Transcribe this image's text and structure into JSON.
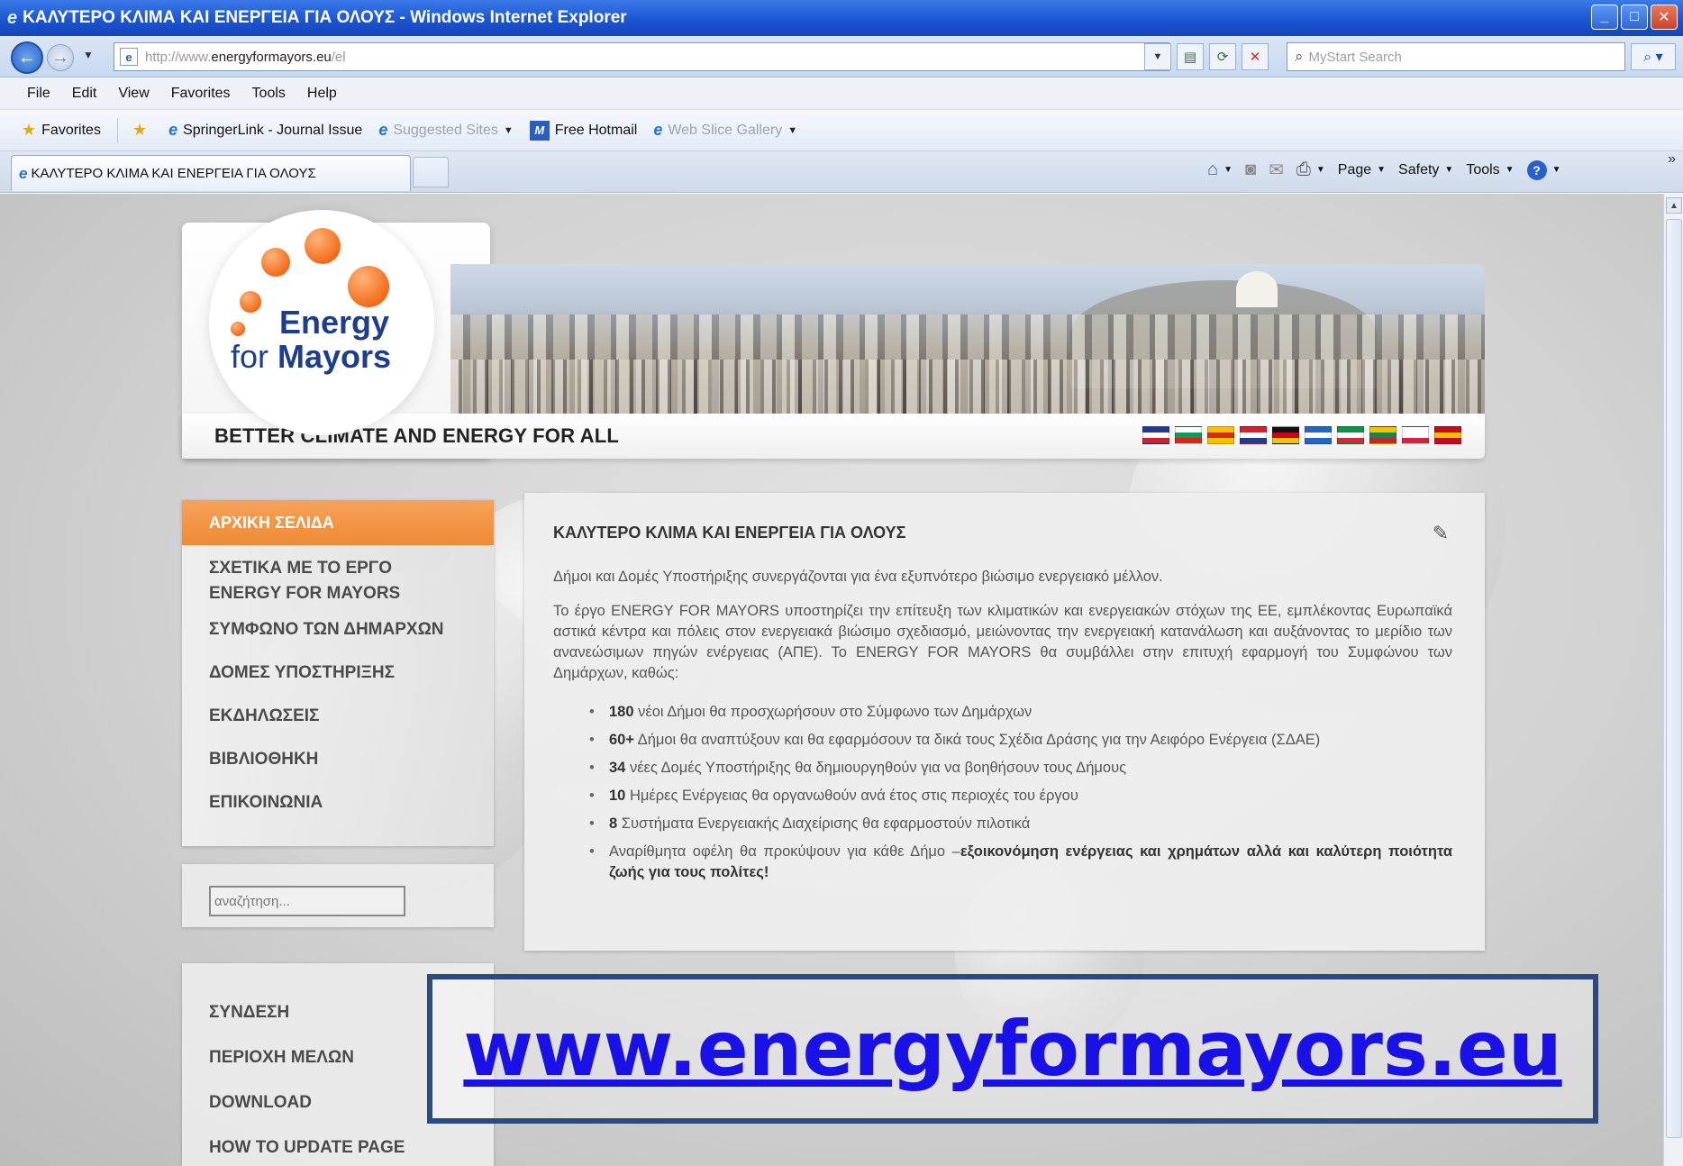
{
  "window": {
    "title": "ΚΑΛΥΤΕΡΟ ΚΛΙΜΑ ΚΑΙ ΕΝΕΡΓΕΙΑ ΓΙΑ ΟΛΟΥΣ - Windows Internet Explorer",
    "controls": {
      "minimize": "_",
      "maximize": "□",
      "close": "✕"
    }
  },
  "address_bar": {
    "url_prefix": "http://www.",
    "url_domain": "energyformayors.eu",
    "url_suffix": "/el",
    "search_placeholder": "MyStart Search"
  },
  "menu": [
    "File",
    "Edit",
    "View",
    "Favorites",
    "Tools",
    "Help"
  ],
  "favorites_bar": {
    "favorites_label": "Favorites",
    "items": [
      {
        "label": "SpringerLink - Journal Issue",
        "dim": false
      },
      {
        "label": "Suggested Sites",
        "dim": true
      },
      {
        "label": "Free Hotmail",
        "dim": false
      },
      {
        "label": "Web Slice Gallery",
        "dim": true
      }
    ]
  },
  "tab": {
    "title": "ΚΑΛΥΤΕΡΟ ΚΛΙΜΑ ΚΑΙ ΕΝΕΡΓΕΙΑ ΓΙΑ ΟΛΟΥΣ"
  },
  "command_bar": {
    "page": "Page",
    "safety": "Safety",
    "tools": "Tools"
  },
  "site": {
    "logo": {
      "line1": "Energy",
      "line2_prefix": "for ",
      "line2_bold": "Mayors"
    },
    "tagline": "BETTER CLIMATE AND ENERGY FOR ALL",
    "flags": [
      {
        "code": "en",
        "colors": [
          "#1f3a93",
          "#ffffff",
          "#cf1f2e"
        ]
      },
      {
        "code": "bg",
        "colors": [
          "#ffffff",
          "#139957",
          "#d62612"
        ]
      },
      {
        "code": "ca",
        "colors": [
          "#f6c000",
          "#d42a1c",
          "#f6c000"
        ]
      },
      {
        "code": "hr",
        "colors": [
          "#d8202a",
          "#ffffff",
          "#1b3d95"
        ]
      },
      {
        "code": "de",
        "colors": [
          "#111111",
          "#d0021b",
          "#f5c400"
        ]
      },
      {
        "code": "el",
        "colors": [
          "#2565c4",
          "#ffffff",
          "#2565c4"
        ]
      },
      {
        "code": "it",
        "colors": [
          "#11924a",
          "#ffffff",
          "#cf2b37"
        ]
      },
      {
        "code": "lt",
        "colors": [
          "#f4c200",
          "#16864a",
          "#c1272d"
        ]
      },
      {
        "code": "pl",
        "colors": [
          "#ffffff",
          "#ffffff",
          "#d4213d"
        ]
      },
      {
        "code": "es",
        "colors": [
          "#c60b1e",
          "#f1bf00",
          "#c60b1e"
        ]
      }
    ],
    "nav": [
      {
        "label": "ΑΡΧΙΚΗ ΣΕΛΙΔΑ",
        "active": true
      },
      {
        "label": "ΣΧΕΤΙΚΑ ΜΕ ΤΟ ΕΡΓΟ ENERGY FOR MAYORS",
        "active": false
      },
      {
        "label": "ΣΥΜΦΩΝΟ ΤΩΝ ΔΗΜΑΡΧΩΝ",
        "active": false
      },
      {
        "label": "ΔΟΜΕΣ ΥΠΟΣΤΗΡΙΞΗΣ",
        "active": false
      },
      {
        "label": "ΕΚΔΗΛΩΣΕΙΣ",
        "active": false
      },
      {
        "label": "ΒΙΒΛΙΟΘΗΚΗ",
        "active": false
      },
      {
        "label": "ΕΠΙΚΟΙΝΩΝΙΑ",
        "active": false
      }
    ],
    "search_placeholder": "αναζήτηση...",
    "user_links": [
      "ΣΥΝΔΕΣΗ",
      "ΠΕΡΙΟΧΗ ΜΕΛΩΝ",
      "DOWNLOAD",
      "HOW TO UPDATE PAGE"
    ],
    "content": {
      "title": "ΚΑΛΥΤΕΡΟ ΚΛΙΜΑ ΚΑΙ ΕΝΕΡΓΕΙΑ ΓΙΑ ΟΛΟΥΣ",
      "intro": "Δήμοι και Δομές Υποστήριξης συνεργάζονται για  ένα εξυπνότερο βιώσιμο ενεργειακό μέλλον.",
      "paragraph": "Το έργο ENERGY FOR MAYORS υποστηρίζει την επίτευξη των κλιματικών και ενεργειακών στόχων της ΕΕ, εμπλέκοντας Ευρωπαϊκά αστικά κέντρα και πόλεις στον ενεργειακά βιώσιμο σχεδιασμό, μειώνοντας την ενεργειακή κατανάλωση και αυξάνοντας το μερίδιο των ανανεώσιμων πηγών ενέργειας (ΑΠΕ). Το ENERGY FOR MAYORS θα συμβάλλει στην επιτυχή εφαρμογή του Συμφώνου των Δημάρχων, καθώς:",
      "bullets": [
        {
          "num": "180",
          "text": " νέοι Δήμοι θα προσχωρήσουν στο Σύμφωνο των Δημάρχων"
        },
        {
          "num": "60+",
          "text": " Δήμοι θα αναπτύξουν και θα εφαρμόσουν τα δικά τους Σχέδια Δράσης για την Αειφόρο Ενέργεια (ΣΔΑΕ)"
        },
        {
          "num": "34",
          "text": " νέες Δομές Υποστήριξης θα δημιουργηθούν  για να βοηθήσουν τους Δήμους"
        },
        {
          "num": "10",
          "text": " Ημέρες Ενέργειας θα οργανωθούν ανά έτος στις περιοχές του έργου"
        },
        {
          "num": "8",
          "text": " Συστήματα Ενεργειακής Διαχείρισης θα εφαρμοστούν πιλοτικά"
        }
      ],
      "last_bullet_plain": " Αναρίθμητα οφέλη θα προκύψουν για κάθε Δήμο –",
      "last_bullet_bold": "εξοικονόμηση ενέργειας και χρημάτων αλλά και καλύτερη ποιότητα ζωής για τους πολίτες!"
    }
  },
  "overlay": {
    "url_text": "www.energyformayors.eu"
  }
}
